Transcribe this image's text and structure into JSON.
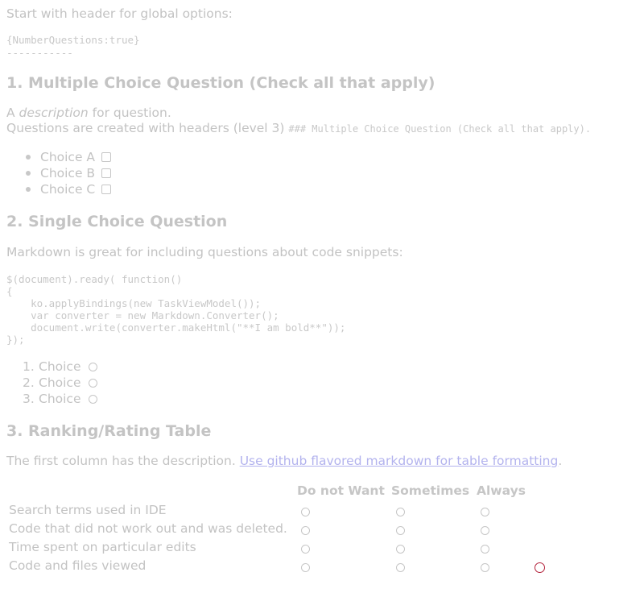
{
  "intro": {
    "text": "Start with header for global options:"
  },
  "global_options": {
    "line1": "{NumberQuestions:true}",
    "line2": "-----------"
  },
  "q1": {
    "title": "1. Multiple Choice Question (Check all that apply)",
    "desc_prefix": "A ",
    "desc_em": "description",
    "desc_suffix": " for question.",
    "headers_text": "Questions are created with headers (level 3) ",
    "headers_code": "### Multiple Choice Question (Check all that apply).",
    "choices": [
      "Choice A",
      "Choice B",
      "Choice C"
    ]
  },
  "q2": {
    "title": "2. Single Choice Question",
    "desc": "Markdown is great for including questions about code snippets:",
    "code": "$(document).ready( function()\n{\n    ko.applyBindings(new TaskViewModel());\n    var converter = new Markdown.Converter();\n    document.write(converter.makeHtml(\"**I am bold**\"));\n});",
    "choices": [
      {
        "num": "1.",
        "label": "Choice"
      },
      {
        "num": "2.",
        "label": "Choice"
      },
      {
        "num": "3.",
        "label": "Choice"
      }
    ]
  },
  "q3": {
    "title": "3. Ranking/Rating Table",
    "desc": "The first column has the description. ",
    "link_text": "Use github flavored markdown for table formatting",
    "desc_end": ".",
    "columns": [
      "Do not Want",
      "Sometimes",
      "Always"
    ],
    "rows": [
      "Search terms used in IDE",
      "Code that did not work out and was deleted.",
      "Time spent on particular edits",
      "Code and files viewed"
    ]
  },
  "colors": {
    "text": "#c3c3c3",
    "link": "#b3b3ee",
    "focus_ring": "#b3213a"
  },
  "icons": {
    "checkbox": "checkbox-icon",
    "radio": "radio-icon"
  }
}
